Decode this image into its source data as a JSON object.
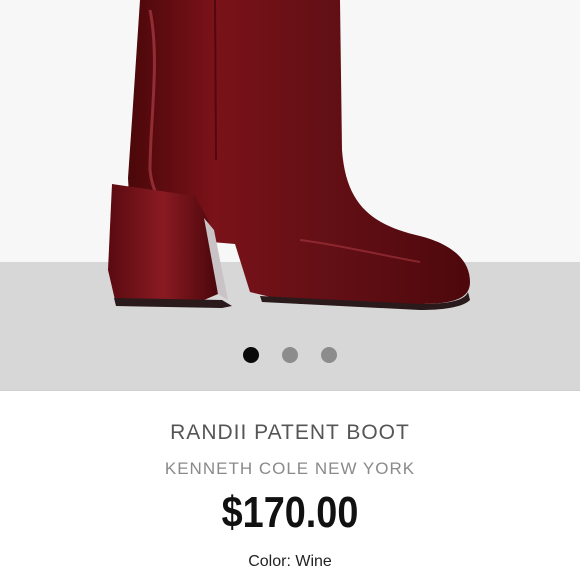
{
  "gallery": {
    "image": "wine-patent-ankle-boot",
    "dot_count": 3,
    "active_index": 0,
    "colors": {
      "background": "#f7f7f7",
      "floor": "#d7d7d7",
      "boot": "#6f0f17",
      "dot_active": "#0a0a0a",
      "dot_inactive": "#8c8c8c"
    }
  },
  "product": {
    "name": "RANDII PATENT BOOT",
    "brand": "KENNETH COLE NEW YORK",
    "price": "$170.00",
    "color_label": "Color:",
    "color_value": "Wine"
  }
}
